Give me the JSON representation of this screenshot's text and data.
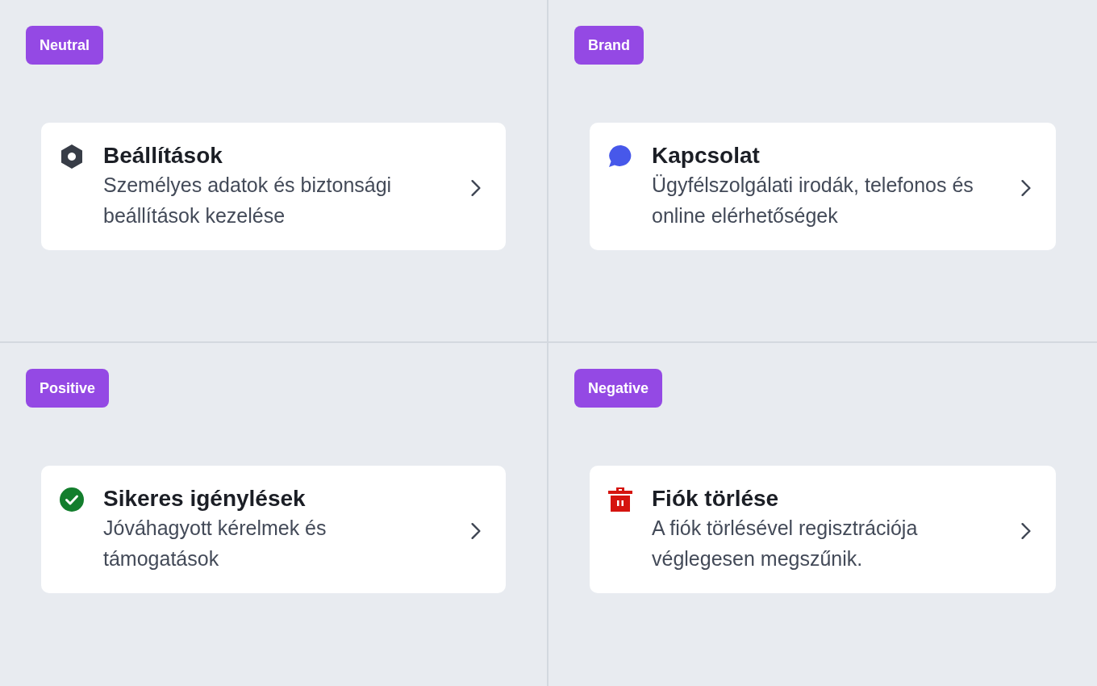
{
  "panels": [
    {
      "badge": "Neutral",
      "card": {
        "kind": "neutral",
        "color": "#383d47",
        "title": "Beállítások",
        "description": "Személyes adatok és biztonsági beállítások kezelése"
      }
    },
    {
      "badge": "Brand",
      "card": {
        "kind": "brand",
        "color": "#4758ea",
        "title": "Kapcsolat",
        "description": "Ügyfélszolgálati irodák, telefonos és online elérhetőségek"
      }
    },
    {
      "badge": "Positive",
      "card": {
        "kind": "positive",
        "color": "#137e2d",
        "title": "Sikeres igénylések",
        "description": "Jóváhagyott kérelmek és támogatások"
      }
    },
    {
      "badge": "Negative",
      "card": {
        "kind": "negative",
        "color": "#d5140f",
        "title": "Fiók törlése",
        "description": "A fiók törlésével regisztrációja véglegesen megszűnik."
      }
    }
  ]
}
